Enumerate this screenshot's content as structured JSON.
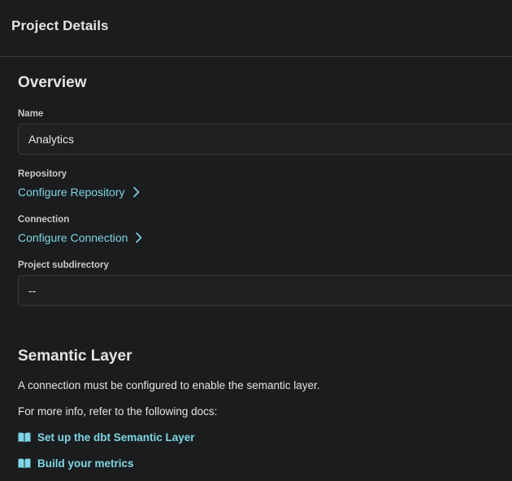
{
  "header": {
    "title": "Project Details"
  },
  "overview": {
    "title": "Overview",
    "name_label": "Name",
    "name_value": "Analytics",
    "repository_label": "Repository",
    "repository_link": "Configure Repository",
    "connection_label": "Connection",
    "connection_link": "Configure Connection",
    "subdirectory_label": "Project subdirectory",
    "subdirectory_value": "--"
  },
  "semantic_layer": {
    "title": "Semantic Layer",
    "message": "A connection must be configured to enable the semantic layer.",
    "docs_intro": "For more info, refer to the following docs:",
    "docs": [
      {
        "label": "Set up the dbt Semantic Layer",
        "icon": "book-icon"
      },
      {
        "label": "Build your metrics",
        "icon": "book-icon"
      }
    ]
  },
  "colors": {
    "background": "#1b1c1e",
    "link": "#7ed6e6",
    "border": "#3a3b3e"
  }
}
